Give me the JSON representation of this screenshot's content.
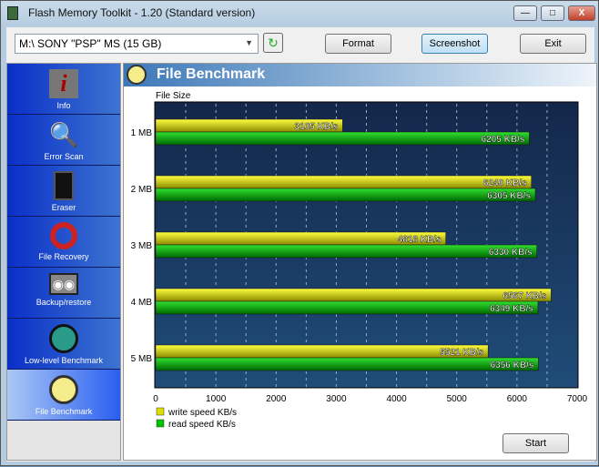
{
  "window": {
    "title": "Flash Memory Toolkit - 1.20 (Standard version)"
  },
  "toolbar": {
    "drive": "M:\\ SONY    \"PSP\" MS (15 GB)",
    "format": "Format",
    "screenshot": "Screenshot",
    "exit": "Exit"
  },
  "sidebar": {
    "items": [
      {
        "label": "Info",
        "icon": "info-icon"
      },
      {
        "label": "Error Scan",
        "icon": "magnifier-icon"
      },
      {
        "label": "Eraser",
        "icon": "trash-icon"
      },
      {
        "label": "File Recovery",
        "icon": "lifebuoy-icon"
      },
      {
        "label": "Backup/restore",
        "icon": "tape-icon"
      },
      {
        "label": "Low-level Benchmark",
        "icon": "stopwatch-icon"
      },
      {
        "label": "File Benchmark",
        "icon": "stopwatch-icon"
      }
    ]
  },
  "panel": {
    "title": "File Benchmark",
    "start": "Start"
  },
  "chart_data": {
    "type": "bar",
    "orientation": "horizontal",
    "ylabel": "File Size",
    "categories": [
      "1 MB",
      "2 MB",
      "3 MB",
      "4 MB",
      "5 MB"
    ],
    "series": [
      {
        "name": "write speed KB/s",
        "color": "#e0e000",
        "values": [
          3105,
          6240,
          4818,
          6567,
          5521
        ]
      },
      {
        "name": "read speed KB/s",
        "color": "#00c000",
        "values": [
          6205,
          6305,
          6330,
          6349,
          6356
        ]
      }
    ],
    "unit": "KB/s",
    "xlim": [
      0,
      7000
    ],
    "xticks": [
      0,
      1000,
      2000,
      3000,
      4000,
      5000,
      6000,
      7000
    ],
    "legend": "bottom-left",
    "grid": true
  }
}
